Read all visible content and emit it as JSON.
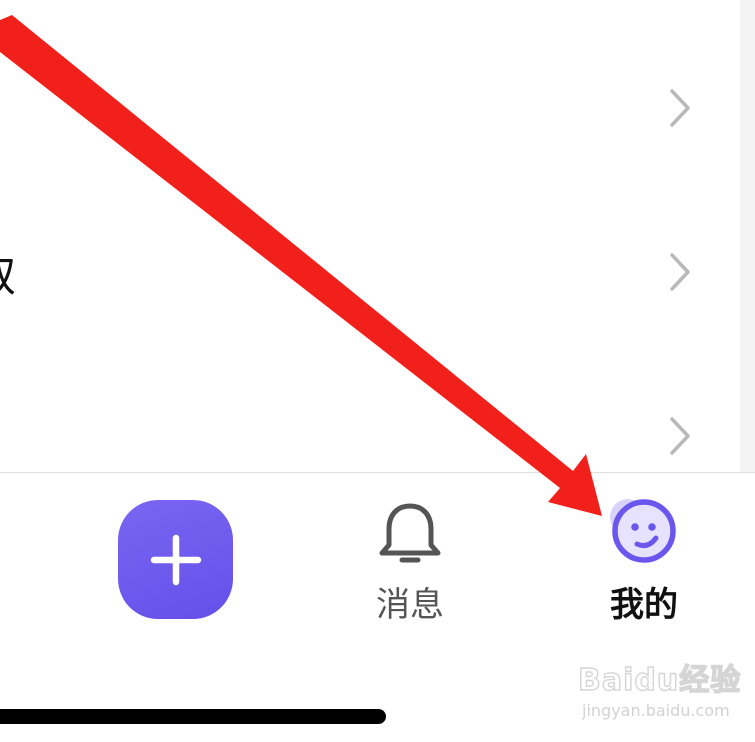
{
  "list": {
    "rows": [
      {
        "label": ""
      },
      {
        "label": "取"
      },
      {
        "label": ""
      }
    ]
  },
  "tabbar": {
    "add_icon": "plus-icon",
    "tabs": [
      {
        "label": "消息",
        "icon": "bell-icon"
      },
      {
        "label": "我的",
        "icon": "smile-face-icon",
        "active": true
      }
    ]
  },
  "colors": {
    "accent": "#6B57EE",
    "arrow": "#F2201A",
    "active_label": "#111111",
    "inactive_label": "#555555"
  },
  "watermark": {
    "main": "Baidu经验",
    "sub": "jingyan.baidu.com"
  }
}
